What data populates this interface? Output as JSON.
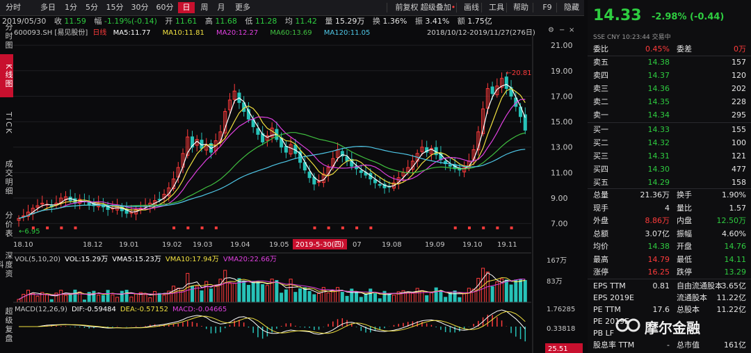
{
  "toolbar": {
    "left": [
      "分时",
      "多日",
      "1分",
      "5分",
      "15分",
      "30分",
      "60分",
      "日",
      "周",
      "月",
      "更多"
    ],
    "right": [
      "前复权",
      "超级叠加",
      "画线",
      "工具",
      "帮助",
      "F9",
      "隐藏"
    ],
    "active": "日"
  },
  "vtabs": [
    "分时图",
    "K线图",
    "TICK",
    "成交明细",
    "分价表",
    "深度资料",
    "超级复盘"
  ],
  "info": {
    "date": "2019/05/30",
    "close_label": "收",
    "close": "11.59",
    "chg_label": "幅",
    "chg": "-1.19%(-0.14)",
    "open_label": "开",
    "open": "11.61",
    "high_label": "高",
    "high": "11.68",
    "low_label": "低",
    "low": "11.28",
    "avg_label": "均",
    "avg": "11.42",
    "vol_label": "量",
    "vol": "15.29万",
    "turn_label": "换",
    "turn": "1.36%",
    "amp_label": "振",
    "amp": "3.41%",
    "amt_label": "额",
    "amt": "1.75亿"
  },
  "ma": {
    "code": "600093.SH",
    "name": "[易见股份]",
    "tag": "日线",
    "ma5": "MA5:11.77",
    "ma10": "MA10:11.81",
    "ma20": "MA20:12.27",
    "ma60": "MA60:13.69",
    "ma120": "MA120:11.05",
    "range": "2018/10/12-2019/11/27(276日)"
  },
  "colors": {
    "ma5": "#ffffff",
    "ma10": "#f0e040",
    "ma20": "#e040e0",
    "ma60": "#40c040",
    "ma120": "#4fc8e8",
    "up": "#ff3b3b",
    "down": "#27c2b8"
  },
  "price_axis": [
    "21.00",
    "19.00",
    "17.00",
    "15.00",
    "13.00",
    "11.00",
    "9.00",
    "7.00"
  ],
  "date_axis": [
    "18.10",
    "18.12",
    "19.01",
    "19.02",
    "19.03",
    "19.04",
    "19.05",
    "07",
    "19.08",
    "19.09",
    "19.10",
    "19.11"
  ],
  "cursor_date": "2019-5-30(四)",
  "annotations": {
    "max": "20.81",
    "min": "6.95"
  },
  "vol": {
    "title": "VOL(5,10,20)",
    "vol": "VOL:15.29万",
    "vma5": "VMA5:15.23万",
    "vma10": "VMA10:17.94万",
    "vma20": "VMA20:22.66万",
    "axis": [
      "167万",
      "83万"
    ]
  },
  "macd": {
    "title": "MACD(12,26,9)",
    "dif": "DIF:-0.59484",
    "dea": "DEA:-0.57152",
    "macd": "MACD:-0.04665",
    "axis": [
      "1.76285",
      "0.33818"
    ],
    "current": "25.51"
  },
  "quote": {
    "price": "14.33",
    "change": "-2.98% (-0.44)",
    "meta": "SSE  CNY   10:23:44  交易中",
    "weibi_label": "委比",
    "weibi": "0.45%",
    "weicha_label": "委差",
    "weicha": "0万",
    "asks": [
      {
        "label": "卖五",
        "price": "14.38",
        "vol": "157"
      },
      {
        "label": "卖四",
        "price": "14.37",
        "vol": "120"
      },
      {
        "label": "卖三",
        "price": "14.36",
        "vol": "202"
      },
      {
        "label": "卖二",
        "price": "14.35",
        "vol": "228"
      },
      {
        "label": "卖一",
        "price": "14.34",
        "vol": "295"
      }
    ],
    "bids": [
      {
        "label": "买一",
        "price": "14.33",
        "vol": "155"
      },
      {
        "label": "买二",
        "price": "14.32",
        "vol": "100"
      },
      {
        "label": "买三",
        "price": "14.31",
        "vol": "121"
      },
      {
        "label": "买四",
        "price": "14.30",
        "vol": "477"
      },
      {
        "label": "买五",
        "price": "14.29",
        "vol": "158"
      }
    ],
    "stats": [
      {
        "l1": "总量",
        "v1": "21.36万",
        "l2": "换手",
        "v2": "1.90%"
      },
      {
        "l1": "现手",
        "v1": "4",
        "l2": "量比",
        "v2": "1.57"
      },
      {
        "l1": "外盘",
        "v1": "8.86万",
        "l2": "内盘",
        "v2": "12.50万"
      },
      {
        "l1": "总额",
        "v1": "3.07亿",
        "l2": "振幅",
        "v2": "4.60%"
      },
      {
        "l1": "均价",
        "v1": "14.38",
        "l2": "开盘",
        "v2": "14.76"
      },
      {
        "l1": "最高",
        "v1": "14.79",
        "l2": "最低",
        "v2": "14.11"
      },
      {
        "l1": "涨停",
        "v1": "16.25",
        "l2": "跌停",
        "v2": "13.29"
      }
    ],
    "fin": [
      {
        "l1": "EPS TTM",
        "v1": "0.81",
        "l2": "自由流通股本",
        "v2": "3.65亿"
      },
      {
        "l1": "EPS 2019E",
        "v1": "",
        "l2": "流通股本",
        "v2": "11.22亿"
      },
      {
        "l1": "PE TTM",
        "v1": "17.6",
        "l2": "总股本",
        "v2": "11.22亿"
      },
      {
        "l1": "PE 2019E",
        "v1": "",
        "l2": "",
        "v2": ""
      },
      {
        "l1": "PB LF",
        "v1": "",
        "l2": "",
        "v2": ""
      },
      {
        "l1": "股息率 TTM",
        "v1": "-",
        "l2": "总市值",
        "v2": "161亿"
      }
    ],
    "brand": "摩尔金融"
  },
  "chart_data": {
    "type": "candlestick",
    "title": "",
    "ylim": [
      6,
      21.5
    ],
    "series_close": [
      7.4,
      7.6,
      7.9,
      8.2,
      8.4,
      8.6,
      8.5,
      8.3,
      8.6,
      9.0,
      9.1,
      8.8,
      8.6,
      8.9,
      8.7,
      8.5,
      8.4,
      8.6,
      8.3,
      8.1,
      8.2,
      8.4,
      8.0,
      7.8,
      7.9,
      8.1,
      8.2,
      8.4,
      8.6,
      8.8,
      8.9,
      9.3,
      9.8,
      10.5,
      11.4,
      12.5,
      13.8,
      13.0,
      13.6,
      12.9,
      13.2,
      12.6,
      13.5,
      14.2,
      15.8,
      16.7,
      17.4,
      16.5,
      15.8,
      15.2,
      14.6,
      14.0,
      13.4,
      13.9,
      14.5,
      13.6,
      13.0,
      12.6,
      13.2,
      12.5,
      11.8,
      11.2,
      10.6,
      10.1,
      10.3,
      10.9,
      11.4,
      12.1,
      12.8,
      12.3,
      11.9,
      11.5,
      11.3,
      11.0,
      10.8,
      10.5,
      10.2,
      10.0,
      9.8,
      9.9,
      10.2,
      10.6,
      11.0,
      11.4,
      11.9,
      12.5,
      13.0,
      12.6,
      12.9,
      12.4,
      12.0,
      11.7,
      11.5,
      11.3,
      11.2,
      11.4,
      11.9,
      12.8,
      14.2,
      16.0,
      17.6,
      17.2,
      17.8,
      18.4,
      17.6,
      17.0,
      16.2,
      15.4,
      14.33
    ],
    "ma5_note": "moving averages derived from closes"
  }
}
